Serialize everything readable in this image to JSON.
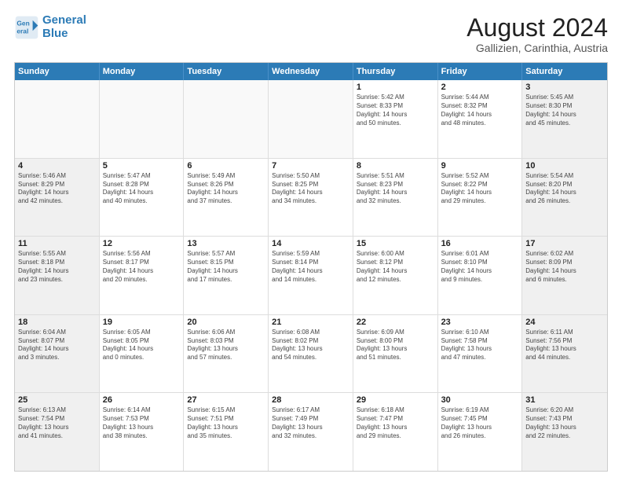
{
  "header": {
    "logo_line1": "General",
    "logo_line2": "Blue",
    "main_title": "August 2024",
    "subtitle": "Gallizien, Carinthia, Austria"
  },
  "days_of_week": [
    "Sunday",
    "Monday",
    "Tuesday",
    "Wednesday",
    "Thursday",
    "Friday",
    "Saturday"
  ],
  "weeks": [
    [
      {
        "day": "",
        "empty": true
      },
      {
        "day": "",
        "empty": true
      },
      {
        "day": "",
        "empty": true
      },
      {
        "day": "",
        "empty": true
      },
      {
        "day": "1",
        "shaded": false,
        "lines": [
          "Sunrise: 5:42 AM",
          "Sunset: 8:33 PM",
          "Daylight: 14 hours",
          "and 50 minutes."
        ]
      },
      {
        "day": "2",
        "shaded": false,
        "lines": [
          "Sunrise: 5:44 AM",
          "Sunset: 8:32 PM",
          "Daylight: 14 hours",
          "and 48 minutes."
        ]
      },
      {
        "day": "3",
        "shaded": true,
        "lines": [
          "Sunrise: 5:45 AM",
          "Sunset: 8:30 PM",
          "Daylight: 14 hours",
          "and 45 minutes."
        ]
      }
    ],
    [
      {
        "day": "4",
        "shaded": true,
        "lines": [
          "Sunrise: 5:46 AM",
          "Sunset: 8:29 PM",
          "Daylight: 14 hours",
          "and 42 minutes."
        ]
      },
      {
        "day": "5",
        "shaded": false,
        "lines": [
          "Sunrise: 5:47 AM",
          "Sunset: 8:28 PM",
          "Daylight: 14 hours",
          "and 40 minutes."
        ]
      },
      {
        "day": "6",
        "shaded": false,
        "lines": [
          "Sunrise: 5:49 AM",
          "Sunset: 8:26 PM",
          "Daylight: 14 hours",
          "and 37 minutes."
        ]
      },
      {
        "day": "7",
        "shaded": false,
        "lines": [
          "Sunrise: 5:50 AM",
          "Sunset: 8:25 PM",
          "Daylight: 14 hours",
          "and 34 minutes."
        ]
      },
      {
        "day": "8",
        "shaded": false,
        "lines": [
          "Sunrise: 5:51 AM",
          "Sunset: 8:23 PM",
          "Daylight: 14 hours",
          "and 32 minutes."
        ]
      },
      {
        "day": "9",
        "shaded": false,
        "lines": [
          "Sunrise: 5:52 AM",
          "Sunset: 8:22 PM",
          "Daylight: 14 hours",
          "and 29 minutes."
        ]
      },
      {
        "day": "10",
        "shaded": true,
        "lines": [
          "Sunrise: 5:54 AM",
          "Sunset: 8:20 PM",
          "Daylight: 14 hours",
          "and 26 minutes."
        ]
      }
    ],
    [
      {
        "day": "11",
        "shaded": true,
        "lines": [
          "Sunrise: 5:55 AM",
          "Sunset: 8:18 PM",
          "Daylight: 14 hours",
          "and 23 minutes."
        ]
      },
      {
        "day": "12",
        "shaded": false,
        "lines": [
          "Sunrise: 5:56 AM",
          "Sunset: 8:17 PM",
          "Daylight: 14 hours",
          "and 20 minutes."
        ]
      },
      {
        "day": "13",
        "shaded": false,
        "lines": [
          "Sunrise: 5:57 AM",
          "Sunset: 8:15 PM",
          "Daylight: 14 hours",
          "and 17 minutes."
        ]
      },
      {
        "day": "14",
        "shaded": false,
        "lines": [
          "Sunrise: 5:59 AM",
          "Sunset: 8:14 PM",
          "Daylight: 14 hours",
          "and 14 minutes."
        ]
      },
      {
        "day": "15",
        "shaded": false,
        "lines": [
          "Sunrise: 6:00 AM",
          "Sunset: 8:12 PM",
          "Daylight: 14 hours",
          "and 12 minutes."
        ]
      },
      {
        "day": "16",
        "shaded": false,
        "lines": [
          "Sunrise: 6:01 AM",
          "Sunset: 8:10 PM",
          "Daylight: 14 hours",
          "and 9 minutes."
        ]
      },
      {
        "day": "17",
        "shaded": true,
        "lines": [
          "Sunrise: 6:02 AM",
          "Sunset: 8:09 PM",
          "Daylight: 14 hours",
          "and 6 minutes."
        ]
      }
    ],
    [
      {
        "day": "18",
        "shaded": true,
        "lines": [
          "Sunrise: 6:04 AM",
          "Sunset: 8:07 PM",
          "Daylight: 14 hours",
          "and 3 minutes."
        ]
      },
      {
        "day": "19",
        "shaded": false,
        "lines": [
          "Sunrise: 6:05 AM",
          "Sunset: 8:05 PM",
          "Daylight: 14 hours",
          "and 0 minutes."
        ]
      },
      {
        "day": "20",
        "shaded": false,
        "lines": [
          "Sunrise: 6:06 AM",
          "Sunset: 8:03 PM",
          "Daylight: 13 hours",
          "and 57 minutes."
        ]
      },
      {
        "day": "21",
        "shaded": false,
        "lines": [
          "Sunrise: 6:08 AM",
          "Sunset: 8:02 PM",
          "Daylight: 13 hours",
          "and 54 minutes."
        ]
      },
      {
        "day": "22",
        "shaded": false,
        "lines": [
          "Sunrise: 6:09 AM",
          "Sunset: 8:00 PM",
          "Daylight: 13 hours",
          "and 51 minutes."
        ]
      },
      {
        "day": "23",
        "shaded": false,
        "lines": [
          "Sunrise: 6:10 AM",
          "Sunset: 7:58 PM",
          "Daylight: 13 hours",
          "and 47 minutes."
        ]
      },
      {
        "day": "24",
        "shaded": true,
        "lines": [
          "Sunrise: 6:11 AM",
          "Sunset: 7:56 PM",
          "Daylight: 13 hours",
          "and 44 minutes."
        ]
      }
    ],
    [
      {
        "day": "25",
        "shaded": true,
        "lines": [
          "Sunrise: 6:13 AM",
          "Sunset: 7:54 PM",
          "Daylight: 13 hours",
          "and 41 minutes."
        ]
      },
      {
        "day": "26",
        "shaded": false,
        "lines": [
          "Sunrise: 6:14 AM",
          "Sunset: 7:53 PM",
          "Daylight: 13 hours",
          "and 38 minutes."
        ]
      },
      {
        "day": "27",
        "shaded": false,
        "lines": [
          "Sunrise: 6:15 AM",
          "Sunset: 7:51 PM",
          "Daylight: 13 hours",
          "and 35 minutes."
        ]
      },
      {
        "day": "28",
        "shaded": false,
        "lines": [
          "Sunrise: 6:17 AM",
          "Sunset: 7:49 PM",
          "Daylight: 13 hours",
          "and 32 minutes."
        ]
      },
      {
        "day": "29",
        "shaded": false,
        "lines": [
          "Sunrise: 6:18 AM",
          "Sunset: 7:47 PM",
          "Daylight: 13 hours",
          "and 29 minutes."
        ]
      },
      {
        "day": "30",
        "shaded": false,
        "lines": [
          "Sunrise: 6:19 AM",
          "Sunset: 7:45 PM",
          "Daylight: 13 hours",
          "and 26 minutes."
        ]
      },
      {
        "day": "31",
        "shaded": true,
        "lines": [
          "Sunrise: 6:20 AM",
          "Sunset: 7:43 PM",
          "Daylight: 13 hours",
          "and 22 minutes."
        ]
      }
    ]
  ]
}
